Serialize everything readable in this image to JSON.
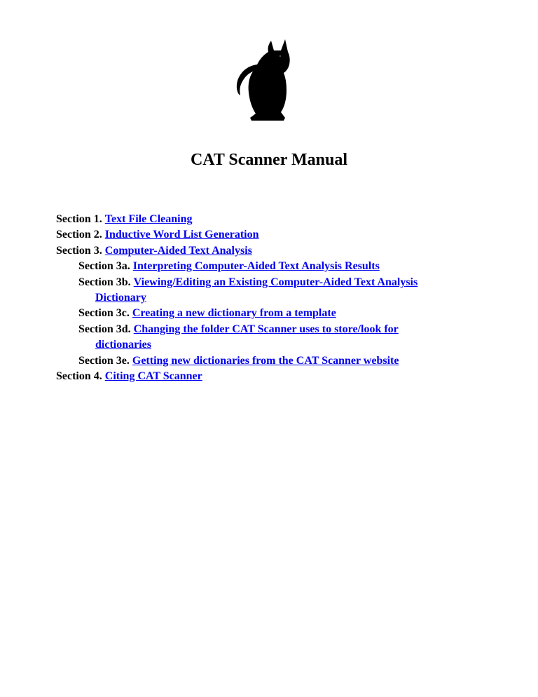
{
  "title": "CAT Scanner Manual",
  "toc": {
    "s1": {
      "label": "Section 1.",
      "link": "Text File Cleaning"
    },
    "s2": {
      "label": "Section 2.",
      "link": "Inductive Word List Generation"
    },
    "s3": {
      "label": "Section 3.",
      "link": "Computer-Aided Text Analysis"
    },
    "s3a": {
      "label": "Section 3a.",
      "link": "Interpreting Computer-Aided Text Analysis Results"
    },
    "s3b": {
      "label": "Section 3b.",
      "link_part1": "Viewing/Editing an Existing Computer-Aided Text Analysis",
      "link_part2": "Dictionary"
    },
    "s3c": {
      "label": "Section 3c.",
      "link": "Creating a new dictionary from a template"
    },
    "s3d": {
      "label": "Section 3d.",
      "link_part1": "Changing the folder CAT Scanner uses to store/look for",
      "link_part2": "dictionaries"
    },
    "s3e": {
      "label": "Section 3e.",
      "link": "Getting new dictionaries from the CAT Scanner website"
    },
    "s4": {
      "label": "Section 4.",
      "link": "Citing CAT Scanner"
    }
  }
}
